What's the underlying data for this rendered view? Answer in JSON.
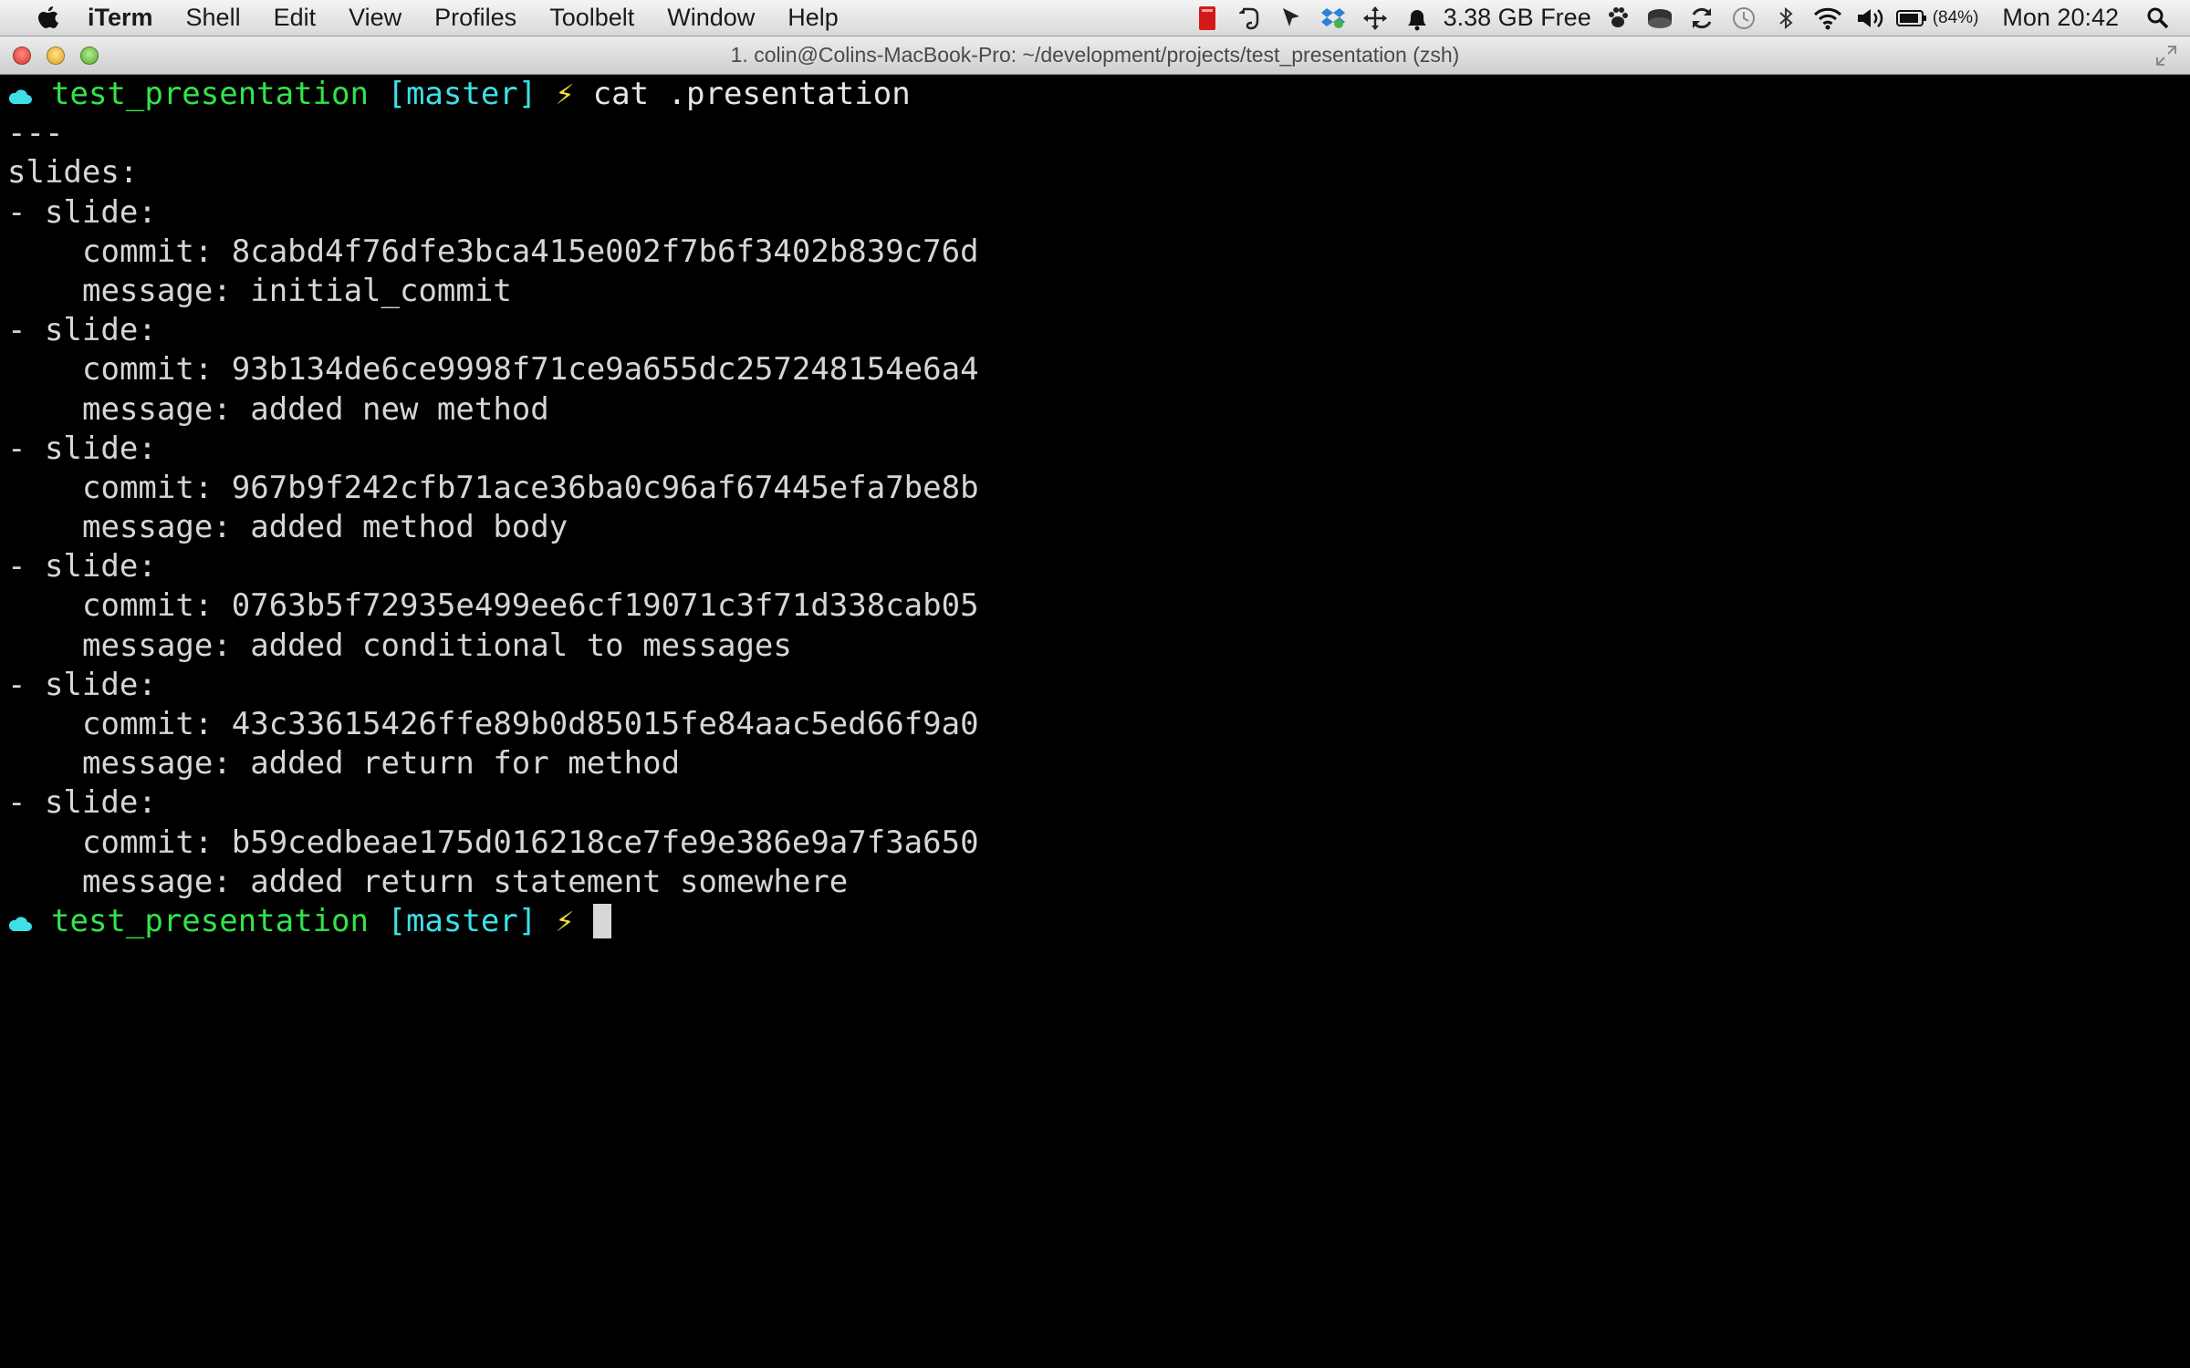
{
  "menubar": {
    "app_name": "iTerm",
    "menus": [
      "Shell",
      "Edit",
      "View",
      "Profiles",
      "Toolbelt",
      "Window",
      "Help"
    ],
    "memory": "3.38 GB Free",
    "battery_percent": "(84%)",
    "clock": "Mon 20:42",
    "icons": [
      "red-book-icon",
      "evernote-icon",
      "pointer-icon",
      "dropbox-icon",
      "move-icon",
      "bell-icon",
      "paw-icon",
      "drive-icon",
      "sync-icon",
      "time-machine-icon",
      "bluetooth-icon",
      "wifi-icon",
      "volume-icon",
      "battery-icon",
      "spotlight-icon"
    ]
  },
  "window": {
    "title": "1. colin@Colins-MacBook-Pro: ~/development/projects/test_presentation (zsh)"
  },
  "terminal": {
    "prompt": {
      "dir": "test_presentation",
      "branch": "[master]",
      "bolt": "⚡"
    },
    "command": "cat .presentation",
    "doc_start": "---",
    "slides_key": "slides:",
    "slide_key": "- slide:",
    "commit_key": "commit: ",
    "message_key": "message: ",
    "slides": [
      {
        "commit": "8cabd4f76dfe3bca415e002f7b6f3402b839c76d",
        "message": "initial_commit"
      },
      {
        "commit": "93b134de6ce9998f71ce9a655dc257248154e6a4",
        "message": "added new method"
      },
      {
        "commit": "967b9f242cfb71ace36ba0c96af67445efa7be8b",
        "message": "added method body"
      },
      {
        "commit": "0763b5f72935e499ee6cf19071c3f71d338cab05",
        "message": "added conditional to messages"
      },
      {
        "commit": "43c33615426ffe89b0d85015fe84aac5ed66f9a0",
        "message": "added return for method"
      },
      {
        "commit": "b59cedbeae175d016218ce7fe9e386e9a7f3a650",
        "message": "added return statement somewhere"
      }
    ]
  },
  "colors": {
    "prompt_dir": "#34e34a",
    "prompt_branch": "#3ee0e6",
    "prompt_bolt": "#f2e23a",
    "terminal_bg": "#000000",
    "terminal_text": "#d6d6d6"
  }
}
